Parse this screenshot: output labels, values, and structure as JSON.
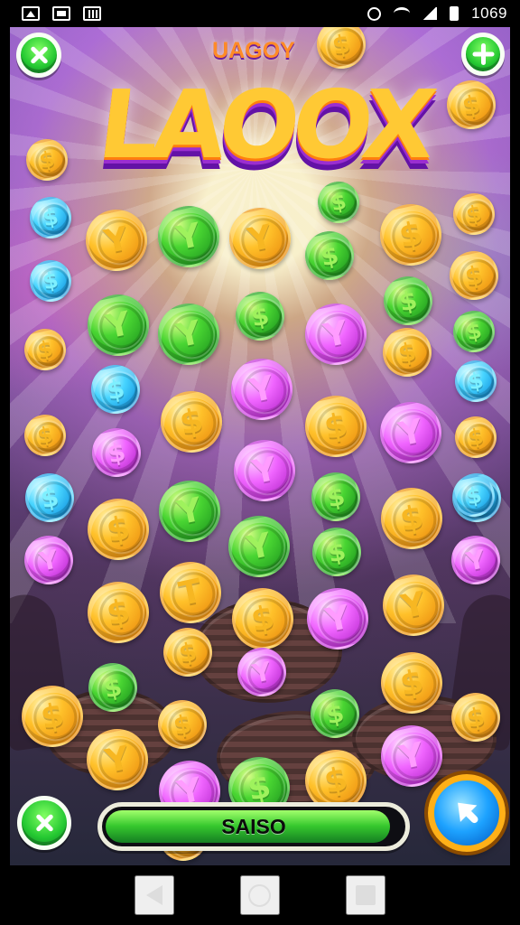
{
  "status_bar": {
    "time": "1069",
    "icons": [
      "app-icon-a",
      "app-icon-b",
      "app-icon-c",
      "clock-icon",
      "wifi-icon",
      "signal-icon",
      "battery-icon"
    ]
  },
  "game": {
    "subtitle": "UAGOY",
    "title": "LAOOX",
    "progress": {
      "label": "SAISO",
      "fill": 0.96
    },
    "buttons": {
      "close": "close-icon",
      "add": "plus-icon",
      "bottom_close": "close-icon",
      "play": "arrow-up-right-icon"
    },
    "coins": [
      {
        "symbol": "$",
        "color": "gold"
      },
      {
        "symbol": "$",
        "color": "gold"
      },
      {
        "symbol": "$",
        "color": "gold"
      },
      {
        "symbol": "$",
        "color": "blue"
      },
      {
        "symbol": "Y",
        "color": "gold"
      },
      {
        "symbol": "Y",
        "color": "green"
      },
      {
        "symbol": "Y",
        "color": "gold"
      },
      {
        "symbol": "$",
        "color": "green"
      },
      {
        "symbol": "$",
        "color": "gold"
      },
      {
        "symbol": "$",
        "color": "gold"
      },
      {
        "symbol": "$",
        "color": "blue"
      },
      {
        "symbol": "$",
        "color": "green"
      },
      {
        "symbol": "$",
        "color": "gold"
      },
      {
        "symbol": "$",
        "color": "gold"
      },
      {
        "symbol": "Y",
        "color": "green"
      },
      {
        "symbol": "Y",
        "color": "green"
      },
      {
        "symbol": "$",
        "color": "green"
      },
      {
        "symbol": "Y",
        "color": "pink"
      },
      {
        "symbol": "$",
        "color": "green"
      },
      {
        "symbol": "$",
        "color": "green"
      },
      {
        "symbol": "$",
        "color": "gold"
      },
      {
        "symbol": "$",
        "color": "blue"
      },
      {
        "symbol": "Y",
        "color": "pink"
      },
      {
        "symbol": "$",
        "color": "gold"
      },
      {
        "symbol": "$",
        "color": "blue"
      },
      {
        "symbol": "$",
        "color": "gold"
      },
      {
        "symbol": "$",
        "color": "pink"
      },
      {
        "symbol": "$",
        "color": "gold"
      },
      {
        "symbol": "Y",
        "color": "pink"
      },
      {
        "symbol": "$",
        "color": "gold"
      },
      {
        "symbol": "Y",
        "color": "pink"
      },
      {
        "symbol": "$",
        "color": "gold"
      },
      {
        "symbol": "$",
        "color": "blue"
      },
      {
        "symbol": "$",
        "color": "gold"
      },
      {
        "symbol": "Y",
        "color": "green"
      },
      {
        "symbol": "$",
        "color": "green"
      },
      {
        "symbol": "$",
        "color": "gold"
      },
      {
        "symbol": "$",
        "color": "blue"
      },
      {
        "symbol": "Y",
        "color": "pink"
      },
      {
        "symbol": "Y",
        "color": "green"
      },
      {
        "symbol": "$",
        "color": "green"
      },
      {
        "symbol": "Y",
        "color": "pink"
      },
      {
        "symbol": "$",
        "color": "gold"
      },
      {
        "symbol": "T",
        "color": "gold"
      },
      {
        "symbol": "$",
        "color": "gold"
      },
      {
        "symbol": "Y",
        "color": "pink"
      },
      {
        "symbol": "Y",
        "color": "gold"
      },
      {
        "symbol": "$",
        "color": "green"
      },
      {
        "symbol": "$",
        "color": "gold"
      },
      {
        "symbol": "Y",
        "color": "pink"
      },
      {
        "symbol": "$",
        "color": "gold"
      },
      {
        "symbol": "$",
        "color": "gold"
      },
      {
        "symbol": "$",
        "color": "gold"
      },
      {
        "symbol": "$",
        "color": "green"
      },
      {
        "symbol": "Y",
        "color": "gold"
      },
      {
        "symbol": "$",
        "color": "gold"
      },
      {
        "symbol": "Y",
        "color": "pink"
      },
      {
        "symbol": "$",
        "color": "green"
      },
      {
        "symbol": "$",
        "color": "gold"
      },
      {
        "symbol": "Y",
        "color": "pink"
      },
      {
        "symbol": "$",
        "color": "gold"
      }
    ]
  },
  "nav_bar": {
    "buttons": [
      "back-icon",
      "home-icon",
      "recent-apps-icon"
    ]
  }
}
